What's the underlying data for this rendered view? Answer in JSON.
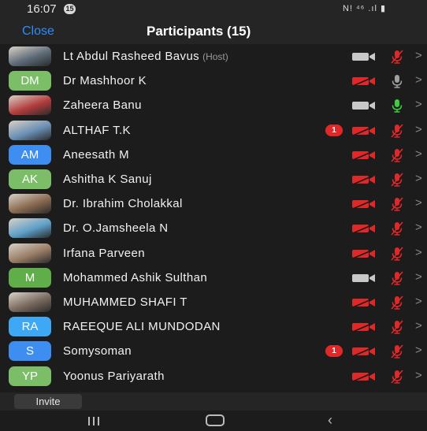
{
  "status_bar": {
    "time": "16:07",
    "notification_badge": "15",
    "indicators": "N! ⁴⁶ .ıl ▮"
  },
  "header": {
    "close_label": "Close",
    "title": "Participants (15)"
  },
  "colors": {
    "accent": "#2d8cff",
    "video_off": "#e02828",
    "video_on": "#c8c8c8",
    "mic_muted": "#e02828",
    "mic_on": "#3ecf3e",
    "mic_idle": "#a0a0a0"
  },
  "participants": [
    {
      "name": "Lt Abdul Rasheed Bavus",
      "host": "(Host)",
      "avatar": {
        "type": "photo",
        "initials": "",
        "color": "#5d6b78"
      },
      "video": "on",
      "mic": "muted",
      "badge": ""
    },
    {
      "name": "Dr Mashhoor K",
      "host": "",
      "avatar": {
        "type": "initials",
        "initials": "DM",
        "color": "#7cbd68"
      },
      "video": "off",
      "mic": "idle",
      "badge": ""
    },
    {
      "name": "Zaheera Banu",
      "host": "",
      "avatar": {
        "type": "photo",
        "initials": "",
        "color": "#b23c3c"
      },
      "video": "on",
      "mic": "on",
      "badge": ""
    },
    {
      "name": "ALTHAF T.K",
      "host": "",
      "avatar": {
        "type": "photo",
        "initials": "",
        "color": "#6a8fb5"
      },
      "video": "off",
      "mic": "muted",
      "badge": "1"
    },
    {
      "name": "Aneesath M",
      "host": "",
      "avatar": {
        "type": "initials",
        "initials": "AM",
        "color": "#3e8ef2"
      },
      "video": "off",
      "mic": "muted",
      "badge": ""
    },
    {
      "name": "Ashitha K Sanuj",
      "host": "",
      "avatar": {
        "type": "initials",
        "initials": "AK",
        "color": "#7cbd68"
      },
      "video": "off",
      "mic": "muted",
      "badge": ""
    },
    {
      "name": "Dr. Ibrahim Cholakkal",
      "host": "",
      "avatar": {
        "type": "photo",
        "initials": "",
        "color": "#8a6a50"
      },
      "video": "off",
      "mic": "muted",
      "badge": ""
    },
    {
      "name": "Dr. O.Jamsheela N",
      "host": "",
      "avatar": {
        "type": "photo",
        "initials": "",
        "color": "#5ea0c8"
      },
      "video": "off",
      "mic": "muted",
      "badge": ""
    },
    {
      "name": "Irfana Parveen",
      "host": "",
      "avatar": {
        "type": "photo",
        "initials": "",
        "color": "#9a7d66"
      },
      "video": "off",
      "mic": "muted",
      "badge": ""
    },
    {
      "name": "Mohammed Ashik Sulthan",
      "host": "",
      "avatar": {
        "type": "initials",
        "initials": "M",
        "color": "#5fae4a"
      },
      "video": "on",
      "mic": "muted",
      "badge": ""
    },
    {
      "name": "MUHAMMED SHAFI T",
      "host": "",
      "avatar": {
        "type": "photo",
        "initials": "",
        "color": "#7a6a5e"
      },
      "video": "off",
      "mic": "muted",
      "badge": ""
    },
    {
      "name": "RAEEQUE ALI MUNDODAN",
      "host": "",
      "avatar": {
        "type": "initials",
        "initials": "RA",
        "color": "#3ea8f5"
      },
      "video": "off",
      "mic": "muted",
      "badge": ""
    },
    {
      "name": "Somysoman",
      "host": "",
      "avatar": {
        "type": "initials",
        "initials": "S",
        "color": "#3e8ef2"
      },
      "video": "off",
      "mic": "muted",
      "badge": "1"
    },
    {
      "name": "Yoonus Pariyarath",
      "host": "",
      "avatar": {
        "type": "initials",
        "initials": "YP",
        "color": "#7cbd68"
      },
      "video": "off",
      "mic": "muted",
      "badge": ""
    }
  ],
  "invite_label": "Invite",
  "nav": {
    "recent_icon": "recent-apps-icon",
    "home_icon": "home-icon",
    "back_icon": "back-icon"
  }
}
